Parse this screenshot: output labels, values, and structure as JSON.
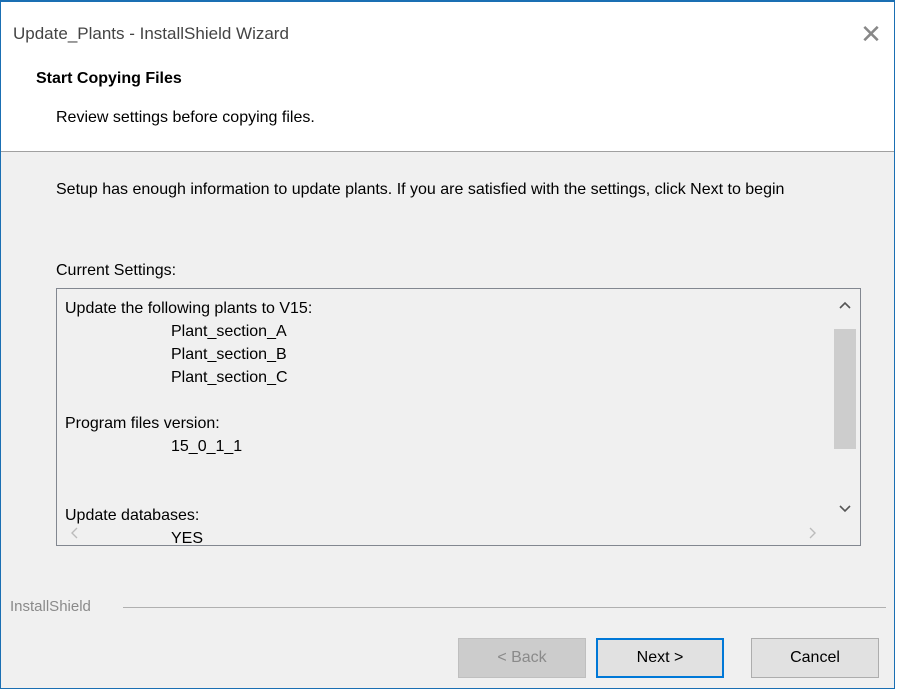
{
  "window": {
    "title": "Update_Plants - InstallShield Wizard",
    "close_glyph": "✕"
  },
  "header": {
    "title": "Start Copying Files",
    "subtitle": "Review settings before copying files."
  },
  "body": {
    "description": "Setup has enough information to update plants. If you are satisfied with the settings, click Next to begin",
    "settings_label": "Current Settings:"
  },
  "settings": {
    "lines": [
      {
        "text": "Update the following plants to V15:",
        "indent": false
      },
      {
        "text": "Plant_section_A",
        "indent": true
      },
      {
        "text": "Plant_section_B",
        "indent": true
      },
      {
        "text": "Plant_section_C",
        "indent": true
      },
      {
        "text": "",
        "indent": false
      },
      {
        "text": "Program files version:",
        "indent": false
      },
      {
        "text": "15_0_1_1",
        "indent": true
      },
      {
        "text": "",
        "indent": false
      },
      {
        "text": "",
        "indent": false
      },
      {
        "text": "Update databases:",
        "indent": false
      },
      {
        "text": "YES",
        "indent": true
      }
    ],
    "scroll_up_icon": "chevron-up-icon",
    "scroll_down_icon": "chevron-down-icon",
    "scroll_left_icon": "chevron-left-icon",
    "scroll_right_icon": "chevron-right-icon"
  },
  "footer": {
    "brand": "InstallShield",
    "back_label": "< Back",
    "next_label": "Next >",
    "cancel_label": "Cancel"
  },
  "colors": {
    "accent": "#0078d7",
    "window_border": "#1a6fb3"
  }
}
